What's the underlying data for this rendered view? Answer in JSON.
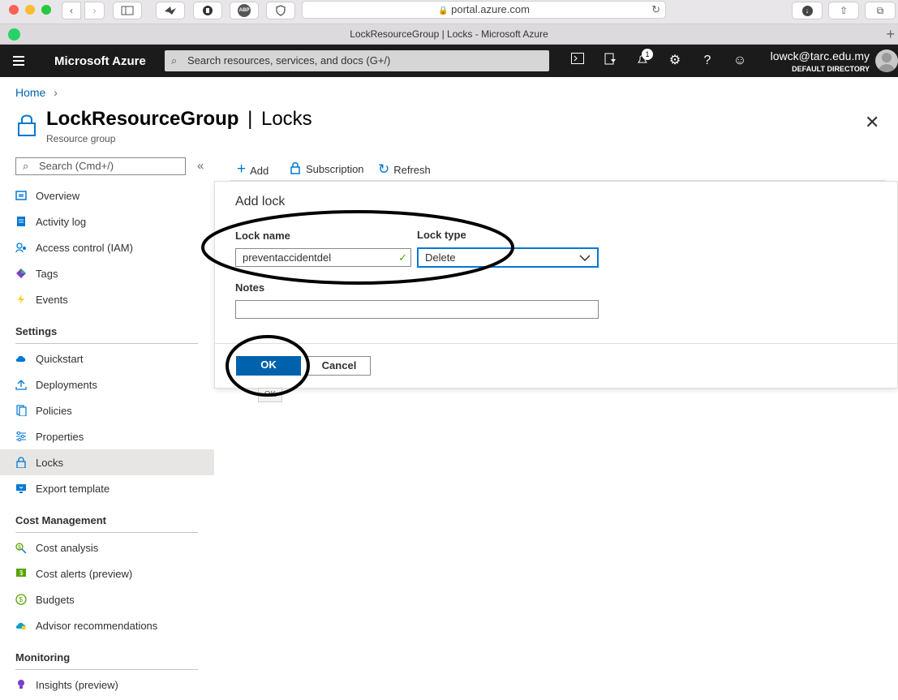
{
  "browser": {
    "url": "portal.azure.com",
    "tab_title": "LockResourceGroup | Locks - Microsoft Azure",
    "abp_label": "ABP"
  },
  "azure": {
    "brand": "Microsoft Azure",
    "search_placeholder": "Search resources, services, and docs (G+/)",
    "notification_count": "1",
    "user_email": "lowck@tarc.edu.my",
    "user_directory": "DEFAULT DIRECTORY"
  },
  "breadcrumb": {
    "home": "Home",
    "separator": "›"
  },
  "page": {
    "title": "LockResourceGroup",
    "title_suffix": "Locks",
    "title_separator": "|",
    "subtitle": "Resource group"
  },
  "sidebar": {
    "search_placeholder": "Search (Cmd+/)",
    "collapse_glyph": "«",
    "items_top": [
      {
        "label": "Overview",
        "icon": "overview-icon"
      },
      {
        "label": "Activity log",
        "icon": "activity-log-icon"
      },
      {
        "label": "Access control (IAM)",
        "icon": "iam-icon"
      },
      {
        "label": "Tags",
        "icon": "tag-icon"
      },
      {
        "label": "Events",
        "icon": "lightning-icon"
      }
    ],
    "section_settings": "Settings",
    "items_settings": [
      {
        "label": "Quickstart",
        "icon": "cloud-icon"
      },
      {
        "label": "Deployments",
        "icon": "upload-icon"
      },
      {
        "label": "Policies",
        "icon": "document-icon"
      },
      {
        "label": "Properties",
        "icon": "sliders-icon"
      },
      {
        "label": "Locks",
        "icon": "lock-icon"
      },
      {
        "label": "Export template",
        "icon": "monitor-icon"
      }
    ],
    "section_cost": "Cost Management",
    "items_cost": [
      {
        "label": "Cost analysis",
        "icon": "cost-icon"
      },
      {
        "label": "Cost alerts (preview)",
        "icon": "cost-alert-icon"
      },
      {
        "label": "Budgets",
        "icon": "budget-icon"
      },
      {
        "label": "Advisor recommendations",
        "icon": "advisor-icon"
      }
    ],
    "section_monitoring": "Monitoring",
    "items_monitoring": [
      {
        "label": "Insights (preview)",
        "icon": "bulb-icon"
      }
    ]
  },
  "toolbar": {
    "add_label": "Add",
    "subscription_label": "Subscription",
    "refresh_label": "Refresh"
  },
  "dialog": {
    "title": "Add lock",
    "lock_name_label": "Lock name",
    "lock_name_value": "preventaccidentdel",
    "lock_type_label": "Lock type",
    "lock_type_value": "Delete",
    "notes_label": "Notes",
    "notes_value": "",
    "ok_label": "OK",
    "cancel_label": "Cancel",
    "tooltip": "OK"
  },
  "colors": {
    "azure_bar": "#1b1b1b",
    "primary_button": "#0062ad",
    "link": "#0062ad",
    "annotation_ring": "#000000"
  }
}
